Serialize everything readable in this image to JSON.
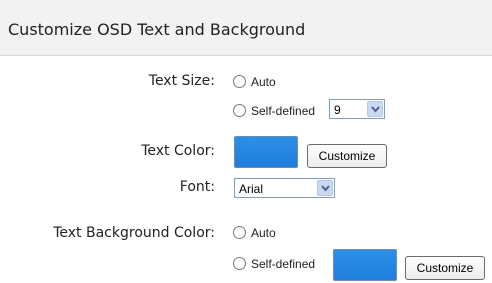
{
  "header": {
    "title": "Customize OSD Text and Background"
  },
  "text_size": {
    "label": "Text Size:",
    "option_auto": "Auto",
    "option_self_defined": "Self-defined",
    "size_value": "9"
  },
  "text_color": {
    "label": "Text Color:",
    "swatch_color": "#2b8fe8",
    "button": "Customize"
  },
  "font": {
    "label": "Font:",
    "value": "Arial"
  },
  "text_background_color": {
    "label": "Text Background Color:",
    "option_auto": "Auto",
    "option_self_defined": "Self-defined",
    "swatch_color": "#2b8fe8",
    "button": "Customize"
  }
}
